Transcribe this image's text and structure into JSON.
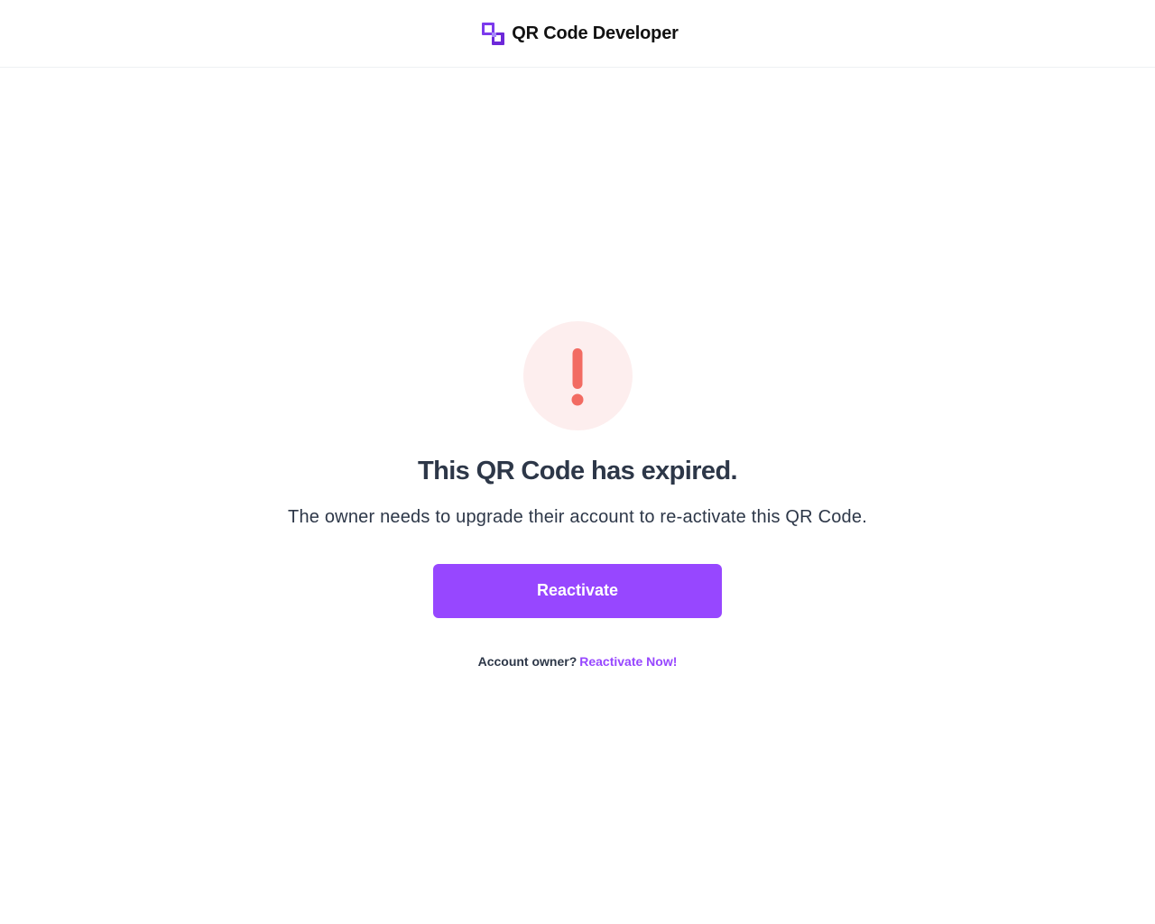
{
  "header": {
    "brand_name": "QR Code Developer",
    "logo_icon": "qr-code-developer-logo-icon"
  },
  "alert": {
    "icon": "exclamation-icon",
    "circle_color": "#fdeeee",
    "icon_color": "#f26b62"
  },
  "main": {
    "title": "This QR Code has expired.",
    "subtitle": "The owner needs to upgrade their account to re-activate this QR Code.",
    "button_label": "Reactivate"
  },
  "footer": {
    "prompt": "Account owner?",
    "link_label": "Reactivate Now!"
  },
  "colors": {
    "accent": "#9747ff",
    "text": "#2d3748",
    "alert": "#f26b62"
  }
}
